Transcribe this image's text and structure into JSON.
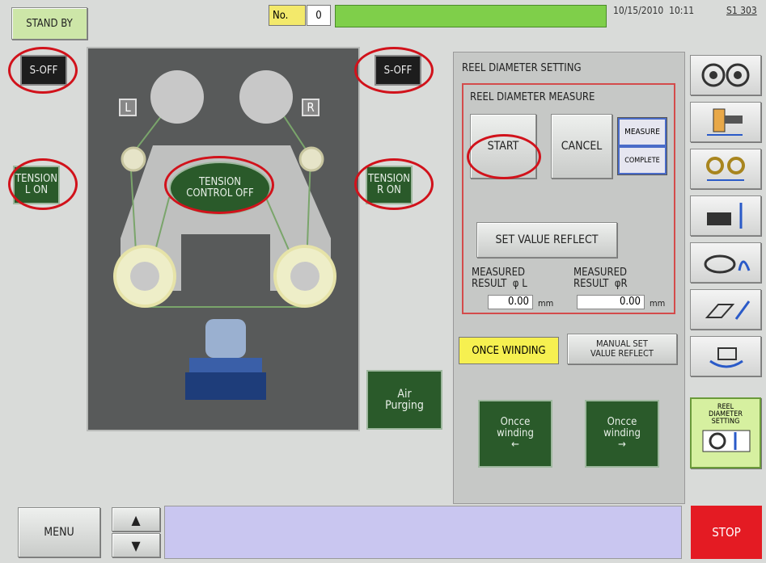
{
  "status": {
    "mode": "STAND BY"
  },
  "header": {
    "no_label": "No.",
    "no_value": "0",
    "datetime": "10/15/2010  10:11",
    "code": "S1 303"
  },
  "machine": {
    "left_soff": "S-OFF",
    "right_soff": "S-OFF",
    "tension_left": "TENSION\nL ON",
    "tension_right": "TENSION\nR ON",
    "tension_control": "TENSION\nCONTROL OFF",
    "label_l": "L",
    "label_r": "R",
    "air_purging": "Air\nPurging"
  },
  "reel_panel": {
    "title": "REEL DIAMETER SETTING",
    "measure_title": "REEL DIAMETER MEASURE",
    "start": "START",
    "cancel": "CANCEL",
    "measure": "MEASURE",
    "complete": "COMPLETE",
    "set_value_reflect": "SET VALUE REFLECT",
    "result_l_label": "MEASURED\nRESULT  φ L",
    "result_r_label": "MEASURED\nRESULT  φR",
    "result_l_value": "0.00",
    "result_r_value": "0.00",
    "unit": "mm",
    "once_winding": "ONCE WINDING",
    "manual_set": "MANUAL SET\nVALUE REFLECT",
    "once_left": "Oncce\nwinding\n←",
    "once_right": "Oncce\nwinding\n→"
  },
  "sidebar": {
    "reel_diameter_setting": "REEL\nDIAMETER\nSETTING"
  },
  "footer": {
    "menu": "MENU",
    "stop": "STOP"
  },
  "colors": {
    "highlight_red": "#d1121b",
    "active_green": "#2a5a2a",
    "status_green": "#7fcf4a",
    "message_bar": "#c9c6f0",
    "stop_red": "#e41b23"
  }
}
